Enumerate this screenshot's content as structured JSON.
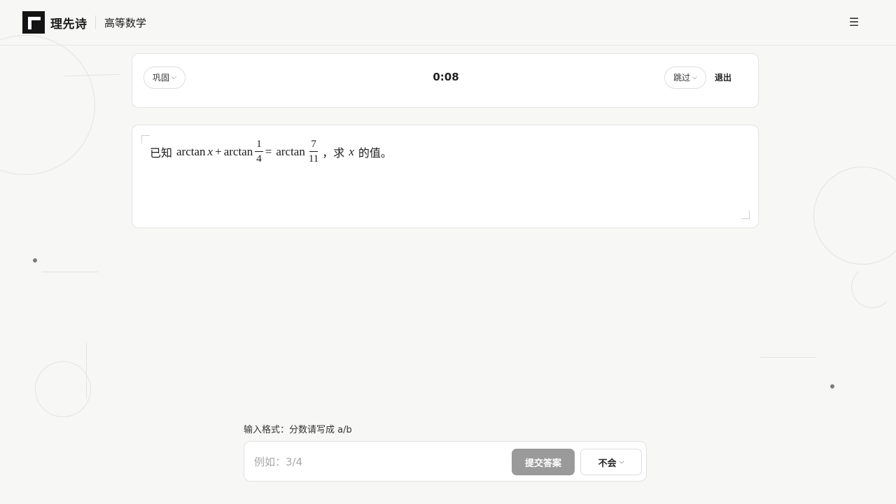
{
  "header": {
    "brand": "理先诗",
    "subject": "高等数学",
    "menu_icon": "☰"
  },
  "controls": {
    "mode_label": "巩固",
    "timer": "0:08",
    "skip_label": "跳过",
    "exit_label": "退出",
    "chevron": "⌄"
  },
  "question": {
    "prefix": "已知",
    "term1_func": "arctan",
    "term1_var": "x",
    "plus": "+",
    "term2_func": "arctan",
    "frac1_num": "1",
    "frac1_den": "4",
    "equals": "=",
    "term3_func": "arctan",
    "frac2_num": "7",
    "frac2_den": "11",
    "comma": "，求",
    "var": "x",
    "suffix": "的值。"
  },
  "answer": {
    "format_hint": "输入格式：分数请写成 a/b",
    "placeholder": "例如：3/4",
    "submit_label": "提交答案",
    "dontknow_label": "不会"
  }
}
